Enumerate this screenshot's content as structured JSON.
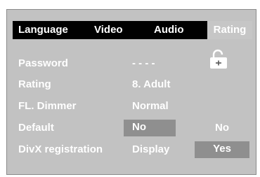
{
  "tabs": [
    {
      "label": "Language"
    },
    {
      "label": "Video"
    },
    {
      "label": "Audio"
    },
    {
      "label": "Rating"
    }
  ],
  "settings": [
    {
      "label": "Password",
      "value": "- - - -"
    },
    {
      "label": "Rating",
      "value": "8. Adult"
    },
    {
      "label": "FL. Dimmer",
      "value": "Normal"
    },
    {
      "label": "Default",
      "value": "No"
    },
    {
      "label": "DivX registration",
      "value": "Display"
    }
  ],
  "options": [
    {
      "label": "No"
    },
    {
      "label": "Yes"
    }
  ],
  "colors": {
    "panel": "#c2c2c2",
    "tabbar": "#000000",
    "active_tab": "#c6c6c6",
    "highlight": "#8f8f8f",
    "text": "#ffffff"
  },
  "icons": {
    "password_lock": "unlocked-padlock-icon"
  }
}
